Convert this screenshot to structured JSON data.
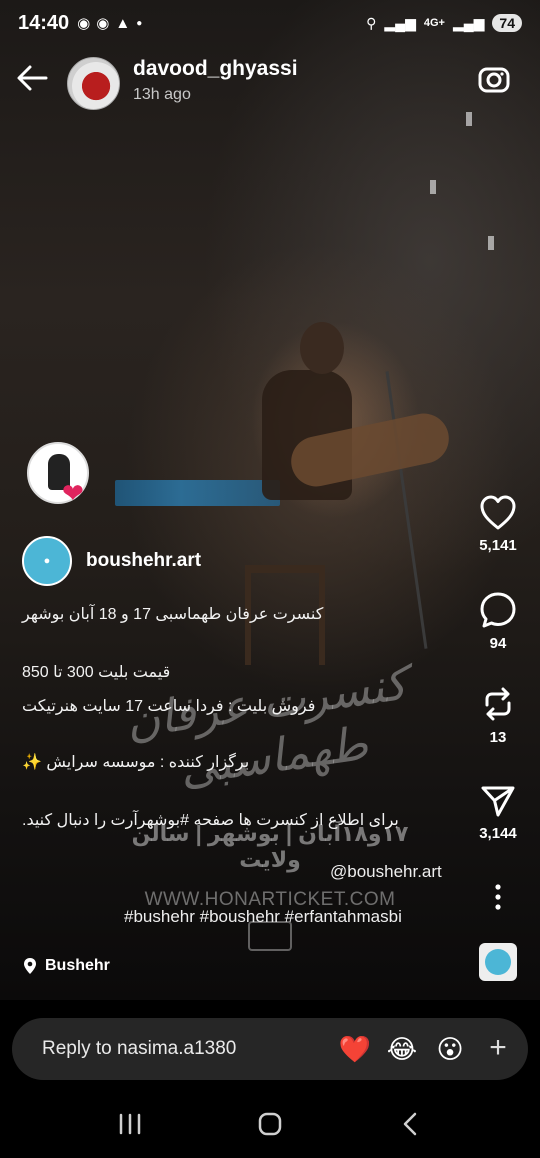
{
  "status_bar": {
    "time": "14:40",
    "network": "4G+",
    "battery": "74",
    "left_icons": [
      "whatsapp-icon",
      "chat-icon",
      "notification-bell-icon",
      "dot-icon"
    ],
    "right_icons": [
      "key-icon",
      "signal-icon",
      "signal-icon"
    ]
  },
  "header": {
    "username": "davood_ghyassi",
    "time_ago": "13h ago",
    "icons": [
      "back-arrow-icon",
      "camera-icon"
    ]
  },
  "post": {
    "author": "boushehr.art",
    "caption_lines": [
      "کنسرت عرفان طهماسبی 17 و 18 آبان بوشهر",
      "قیمت بلیت 300 تا 850",
      "فروش بلیت : فردا ساعت 17 سایت هنرتیکت",
      "برگزار کننده : موسسه سرایش ✨",
      "برای اطلاع از کنسرت ها صفحه #بوشهرآرت را دنبال کنید."
    ],
    "mention": "@boushehr.art",
    "hashtags": "#bushehr #boushehr #erfantahmasbi",
    "location": "Bushehr"
  },
  "watermark": {
    "script": "کنسرت عرفان طهماسبی",
    "line1": "۱۷و۱۸آبان | بوشهر | سالن ولایت",
    "line2": "WWW.HONARTICKET.COM"
  },
  "actions": {
    "likes": "5,141",
    "comments": "94",
    "reposts": "13",
    "shares": "3,144"
  },
  "reply": {
    "placeholder": "Reply to nasima.a1380",
    "quick_reactions": [
      "❤️",
      "😂",
      "😮"
    ],
    "add_symbol": "+"
  },
  "colors": {
    "heart": "#e0245e",
    "author_avatar": "#4cb6d6",
    "reply_bar": "#262626"
  }
}
